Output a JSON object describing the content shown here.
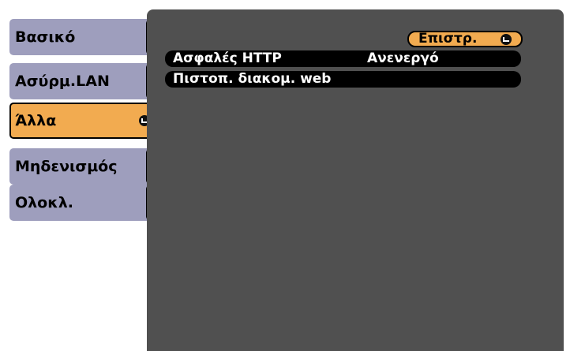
{
  "sidebar": {
    "items": [
      {
        "label": "Βασικό"
      },
      {
        "label": "Ασύρμ.LAN"
      },
      {
        "label": "Άλλα"
      },
      {
        "label": "Μηδενισμός"
      },
      {
        "label": "Ολοκλ."
      }
    ]
  },
  "panel": {
    "back_label": "Επιστρ.",
    "rows": [
      {
        "label": "Ασφαλές HTTP",
        "value": "Ανενεργό"
      },
      {
        "label": "Πιστοπ. διακομ. web"
      }
    ]
  },
  "colors": {
    "sidebar": "#9e9ebd",
    "highlight": "#f2ab50",
    "panel": "#505050",
    "row": "#000000"
  },
  "icons": {
    "enter": "enter-icon"
  }
}
